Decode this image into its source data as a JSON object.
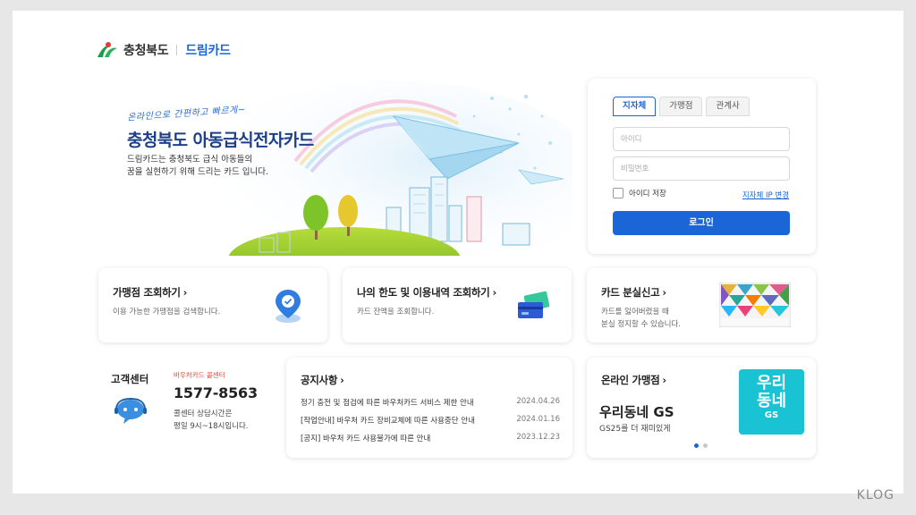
{
  "header": {
    "region": "충청북도",
    "brand": "드림카드"
  },
  "hero": {
    "handwriting": "온라인으로 간편하고 빠르게~",
    "title": "충청북도 아동급식전자카드",
    "desc_line1": "드림카드는 충청북도 급식 아동들의",
    "desc_line2": "꿈을 실현하기 위해 드리는 카드 입니다."
  },
  "login": {
    "tabs": [
      {
        "label": "지자체"
      },
      {
        "label": "가맹점"
      },
      {
        "label": "관계사"
      }
    ],
    "id_placeholder": "아이디",
    "pw_placeholder": "비밀번호",
    "remember_label": "아이디 저장",
    "ip_link": "지자체 IP 변경",
    "login_button": "로그인"
  },
  "cards": {
    "store": {
      "title": "가맹점 조회하기",
      "desc": "이용 가능한 가맹점을 검색합니다."
    },
    "limit": {
      "title": "나의 한도 및 이용내역 조회하기",
      "desc": "카드 잔액을 조회합니다."
    },
    "lost": {
      "title": "카드 분실신고",
      "desc_line1": "카드를 잃어버렸을 때",
      "desc_line2": "분실 정지할 수 있습니다."
    }
  },
  "customer_center": {
    "title": "고객센터",
    "label": "바우처카드 콜센터",
    "phone": "1577-8563",
    "hours_line1": "콜센터 상담시간은",
    "hours_line2": "평일 9시~18시입니다."
  },
  "notices": {
    "title": "공지사항",
    "items": [
      {
        "text": "정기 충전 및 점검에 따른 바우처카드 서비스 제한 안내",
        "date": "2024.04.26"
      },
      {
        "text": "[작업안내] 바우처 카드 장비교체에 따른 사용중단 안내",
        "date": "2024.01.16"
      },
      {
        "text": "[공지] 바우처 카드 사용불가에 따른 안내",
        "date": "2023.12.23"
      }
    ]
  },
  "online_store": {
    "title": "온라인 가맹점",
    "name": "우리동네 GS",
    "desc": "GS25를 더 재미있게",
    "badge_line1": "우리",
    "badge_line2": "동네",
    "badge_line3": "GS"
  },
  "watermark": "KLOG",
  "colors": {
    "accent": "#1a66d6",
    "navy": "#1d3f86",
    "gs_badge": "#19c3d3",
    "cs_label": "#e0463a"
  }
}
